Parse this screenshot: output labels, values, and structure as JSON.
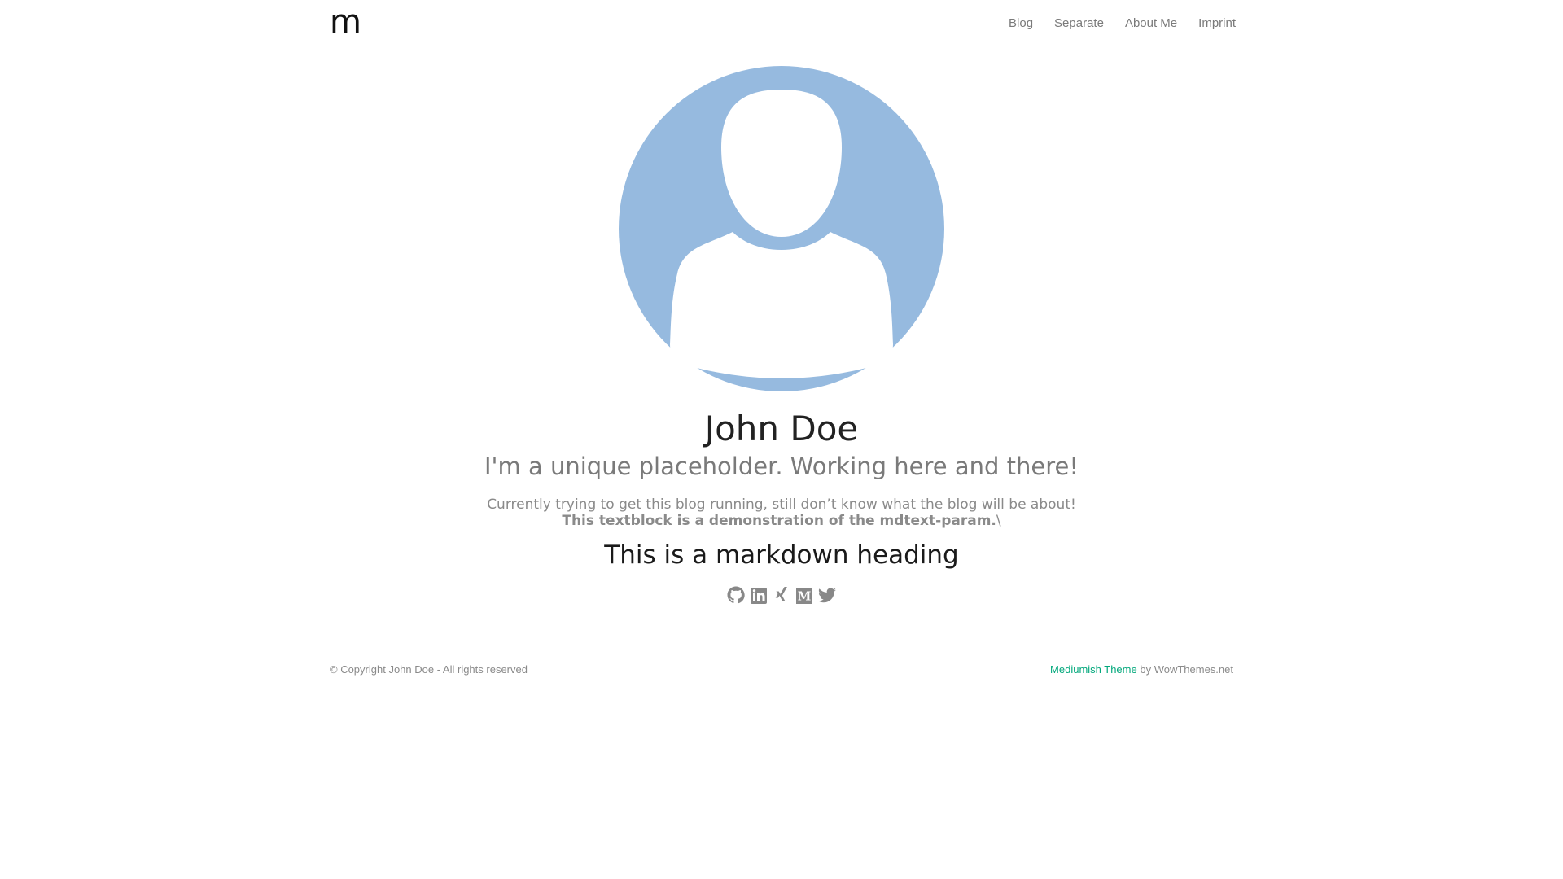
{
  "navbar": {
    "brand": "m",
    "links": [
      {
        "label": "Blog"
      },
      {
        "label": "Separate"
      },
      {
        "label": "About Me"
      },
      {
        "label": "Imprint"
      }
    ]
  },
  "profile": {
    "avatar_icon": "user-placeholder-icon",
    "avatar_color": "#96badf",
    "name": "John Doe",
    "tagline": "I'm a unique placeholder. Working here and there!",
    "description_line1": "Currently trying to get this blog running, still don’t know what the blog will be about!",
    "description_line2_bold": "This textblock is a demonstration of the mdtext-param.",
    "description_line2_suffix": "\\",
    "markdown_heading": "This is a markdown heading"
  },
  "social": [
    {
      "icon": "github-icon"
    },
    {
      "icon": "linkedin-icon"
    },
    {
      "icon": "xing-icon"
    },
    {
      "icon": "medium-icon"
    },
    {
      "icon": "twitter-icon"
    }
  ],
  "footer": {
    "copyright": "© Copyright John Doe - All rights reserved",
    "theme_link": "Mediumish Theme",
    "credit_suffix": " by WowThemes.net",
    "accent_color": "#03a87c"
  }
}
